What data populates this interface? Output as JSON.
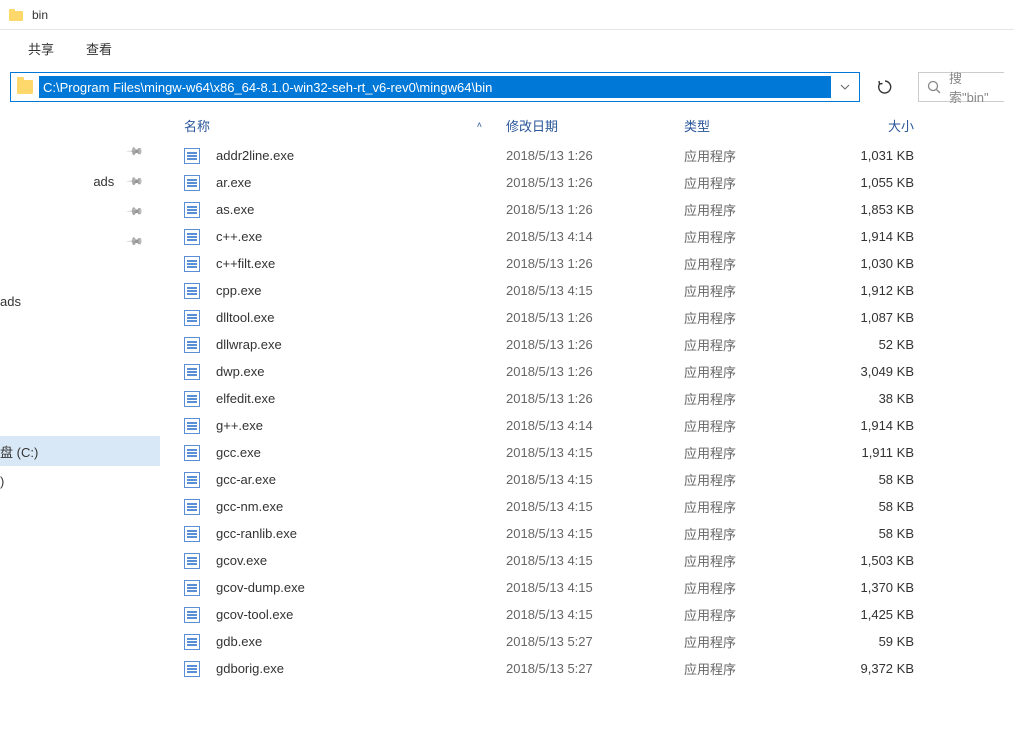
{
  "window": {
    "title": "bin"
  },
  "ribbon": {
    "tab_share": "共享",
    "tab_view": "查看"
  },
  "addressbar": {
    "path": "C:\\Program Files\\mingw-w64\\x86_64-8.1.0-win32-seh-rt_v6-rev0\\mingw64\\bin"
  },
  "search": {
    "placeholder": "搜索\"bin\""
  },
  "sidebar": {
    "items": [
      {
        "label": "",
        "pinned": true
      },
      {
        "label": "ads",
        "pinned": true
      },
      {
        "label": "",
        "pinned": true
      },
      {
        "label": "",
        "pinned": true
      },
      {
        "label": "",
        "pinned": false
      },
      {
        "label": "ads",
        "pinned": false
      },
      {
        "label": "",
        "pinned": false
      },
      {
        "label": "",
        "pinned": false
      },
      {
        "label": "",
        "pinned": false
      },
      {
        "label": "",
        "pinned": false
      },
      {
        "label": "盘 (C:)",
        "pinned": false,
        "selected": true
      },
      {
        "label": ")",
        "pinned": false
      }
    ]
  },
  "columns": {
    "name": "名称",
    "date": "修改日期",
    "type": "类型",
    "size": "大小"
  },
  "files": [
    {
      "name": "addr2line.exe",
      "date": "2018/5/13 1:26",
      "type": "应用程序",
      "size": "1,031 KB"
    },
    {
      "name": "ar.exe",
      "date": "2018/5/13 1:26",
      "type": "应用程序",
      "size": "1,055 KB"
    },
    {
      "name": "as.exe",
      "date": "2018/5/13 1:26",
      "type": "应用程序",
      "size": "1,853 KB"
    },
    {
      "name": "c++.exe",
      "date": "2018/5/13 4:14",
      "type": "应用程序",
      "size": "1,914 KB"
    },
    {
      "name": "c++filt.exe",
      "date": "2018/5/13 1:26",
      "type": "应用程序",
      "size": "1,030 KB"
    },
    {
      "name": "cpp.exe",
      "date": "2018/5/13 4:15",
      "type": "应用程序",
      "size": "1,912 KB"
    },
    {
      "name": "dlltool.exe",
      "date": "2018/5/13 1:26",
      "type": "应用程序",
      "size": "1,087 KB"
    },
    {
      "name": "dllwrap.exe",
      "date": "2018/5/13 1:26",
      "type": "应用程序",
      "size": "52 KB"
    },
    {
      "name": "dwp.exe",
      "date": "2018/5/13 1:26",
      "type": "应用程序",
      "size": "3,049 KB"
    },
    {
      "name": "elfedit.exe",
      "date": "2018/5/13 1:26",
      "type": "应用程序",
      "size": "38 KB"
    },
    {
      "name": "g++.exe",
      "date": "2018/5/13 4:14",
      "type": "应用程序",
      "size": "1,914 KB"
    },
    {
      "name": "gcc.exe",
      "date": "2018/5/13 4:15",
      "type": "应用程序",
      "size": "1,911 KB"
    },
    {
      "name": "gcc-ar.exe",
      "date": "2018/5/13 4:15",
      "type": "应用程序",
      "size": "58 KB"
    },
    {
      "name": "gcc-nm.exe",
      "date": "2018/5/13 4:15",
      "type": "应用程序",
      "size": "58 KB"
    },
    {
      "name": "gcc-ranlib.exe",
      "date": "2018/5/13 4:15",
      "type": "应用程序",
      "size": "58 KB"
    },
    {
      "name": "gcov.exe",
      "date": "2018/5/13 4:15",
      "type": "应用程序",
      "size": "1,503 KB"
    },
    {
      "name": "gcov-dump.exe",
      "date": "2018/5/13 4:15",
      "type": "应用程序",
      "size": "1,370 KB"
    },
    {
      "name": "gcov-tool.exe",
      "date": "2018/5/13 4:15",
      "type": "应用程序",
      "size": "1,425 KB"
    },
    {
      "name": "gdb.exe",
      "date": "2018/5/13 5:27",
      "type": "应用程序",
      "size": "59 KB"
    },
    {
      "name": "gdborig.exe",
      "date": "2018/5/13 5:27",
      "type": "应用程序",
      "size": "9,372 KB"
    }
  ]
}
